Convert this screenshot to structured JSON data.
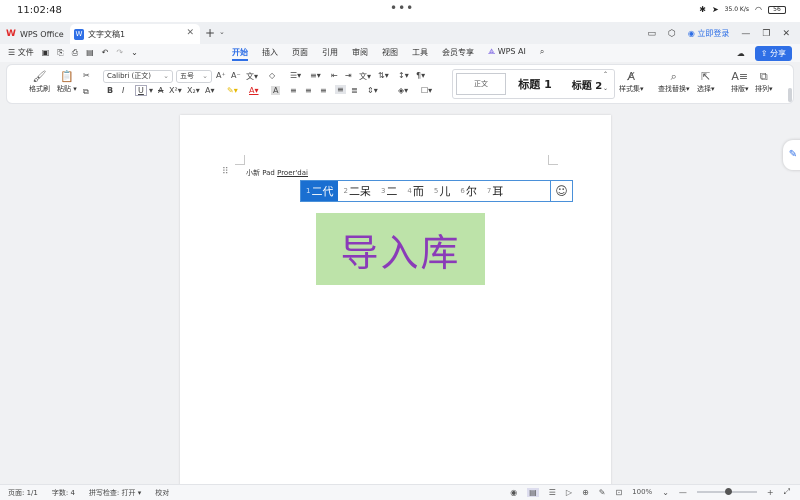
{
  "status": {
    "time": "11:02:48",
    "dots": "•••",
    "signal": "35.0 K/s",
    "battery": "56"
  },
  "tabs": {
    "wps": "WPS Office",
    "doc": "文字文稿1",
    "add": "+",
    "login": "立即登录"
  },
  "menu": {
    "file": "文件",
    "tabs": [
      "开始",
      "插入",
      "页面",
      "引用",
      "审阅",
      "视图",
      "工具",
      "会员专享",
      "WPS AI"
    ],
    "share": "分享"
  },
  "ribbon": {
    "format_painter": "格式刷",
    "paste": "粘贴",
    "font_name": "Calibri (正文)",
    "font_size": "五号",
    "style_normal": "正文",
    "style_h1": "标题 1",
    "style_h2": "标题 2",
    "style_set": "样式集",
    "find_replace": "查找替换",
    "select": "选择",
    "layout": "排版",
    "arrange": "排列"
  },
  "document": {
    "text_prefix": "小新 Pad ",
    "composing": "Proer'dai"
  },
  "ime": {
    "candidates": [
      {
        "num": "1",
        "text": "二代"
      },
      {
        "num": "2",
        "text": "二呆"
      },
      {
        "num": "3",
        "text": "二"
      },
      {
        "num": "4",
        "text": "而"
      },
      {
        "num": "5",
        "text": "儿"
      },
      {
        "num": "6",
        "text": "尔"
      },
      {
        "num": "7",
        "text": "耳"
      }
    ],
    "emoji": "☺"
  },
  "overlay_text": "导入库",
  "footer": {
    "page": "页面: 1/1",
    "words": "字数: 4",
    "spell": "拼写检查: 打开",
    "proof": "校对",
    "zoom": "100%"
  },
  "colors": {
    "accent": "#2f6fe6",
    "ime_active": "#1a6fd1",
    "overlay_bg": "#bde3a9",
    "overlay_text": "#8a3bb8"
  }
}
